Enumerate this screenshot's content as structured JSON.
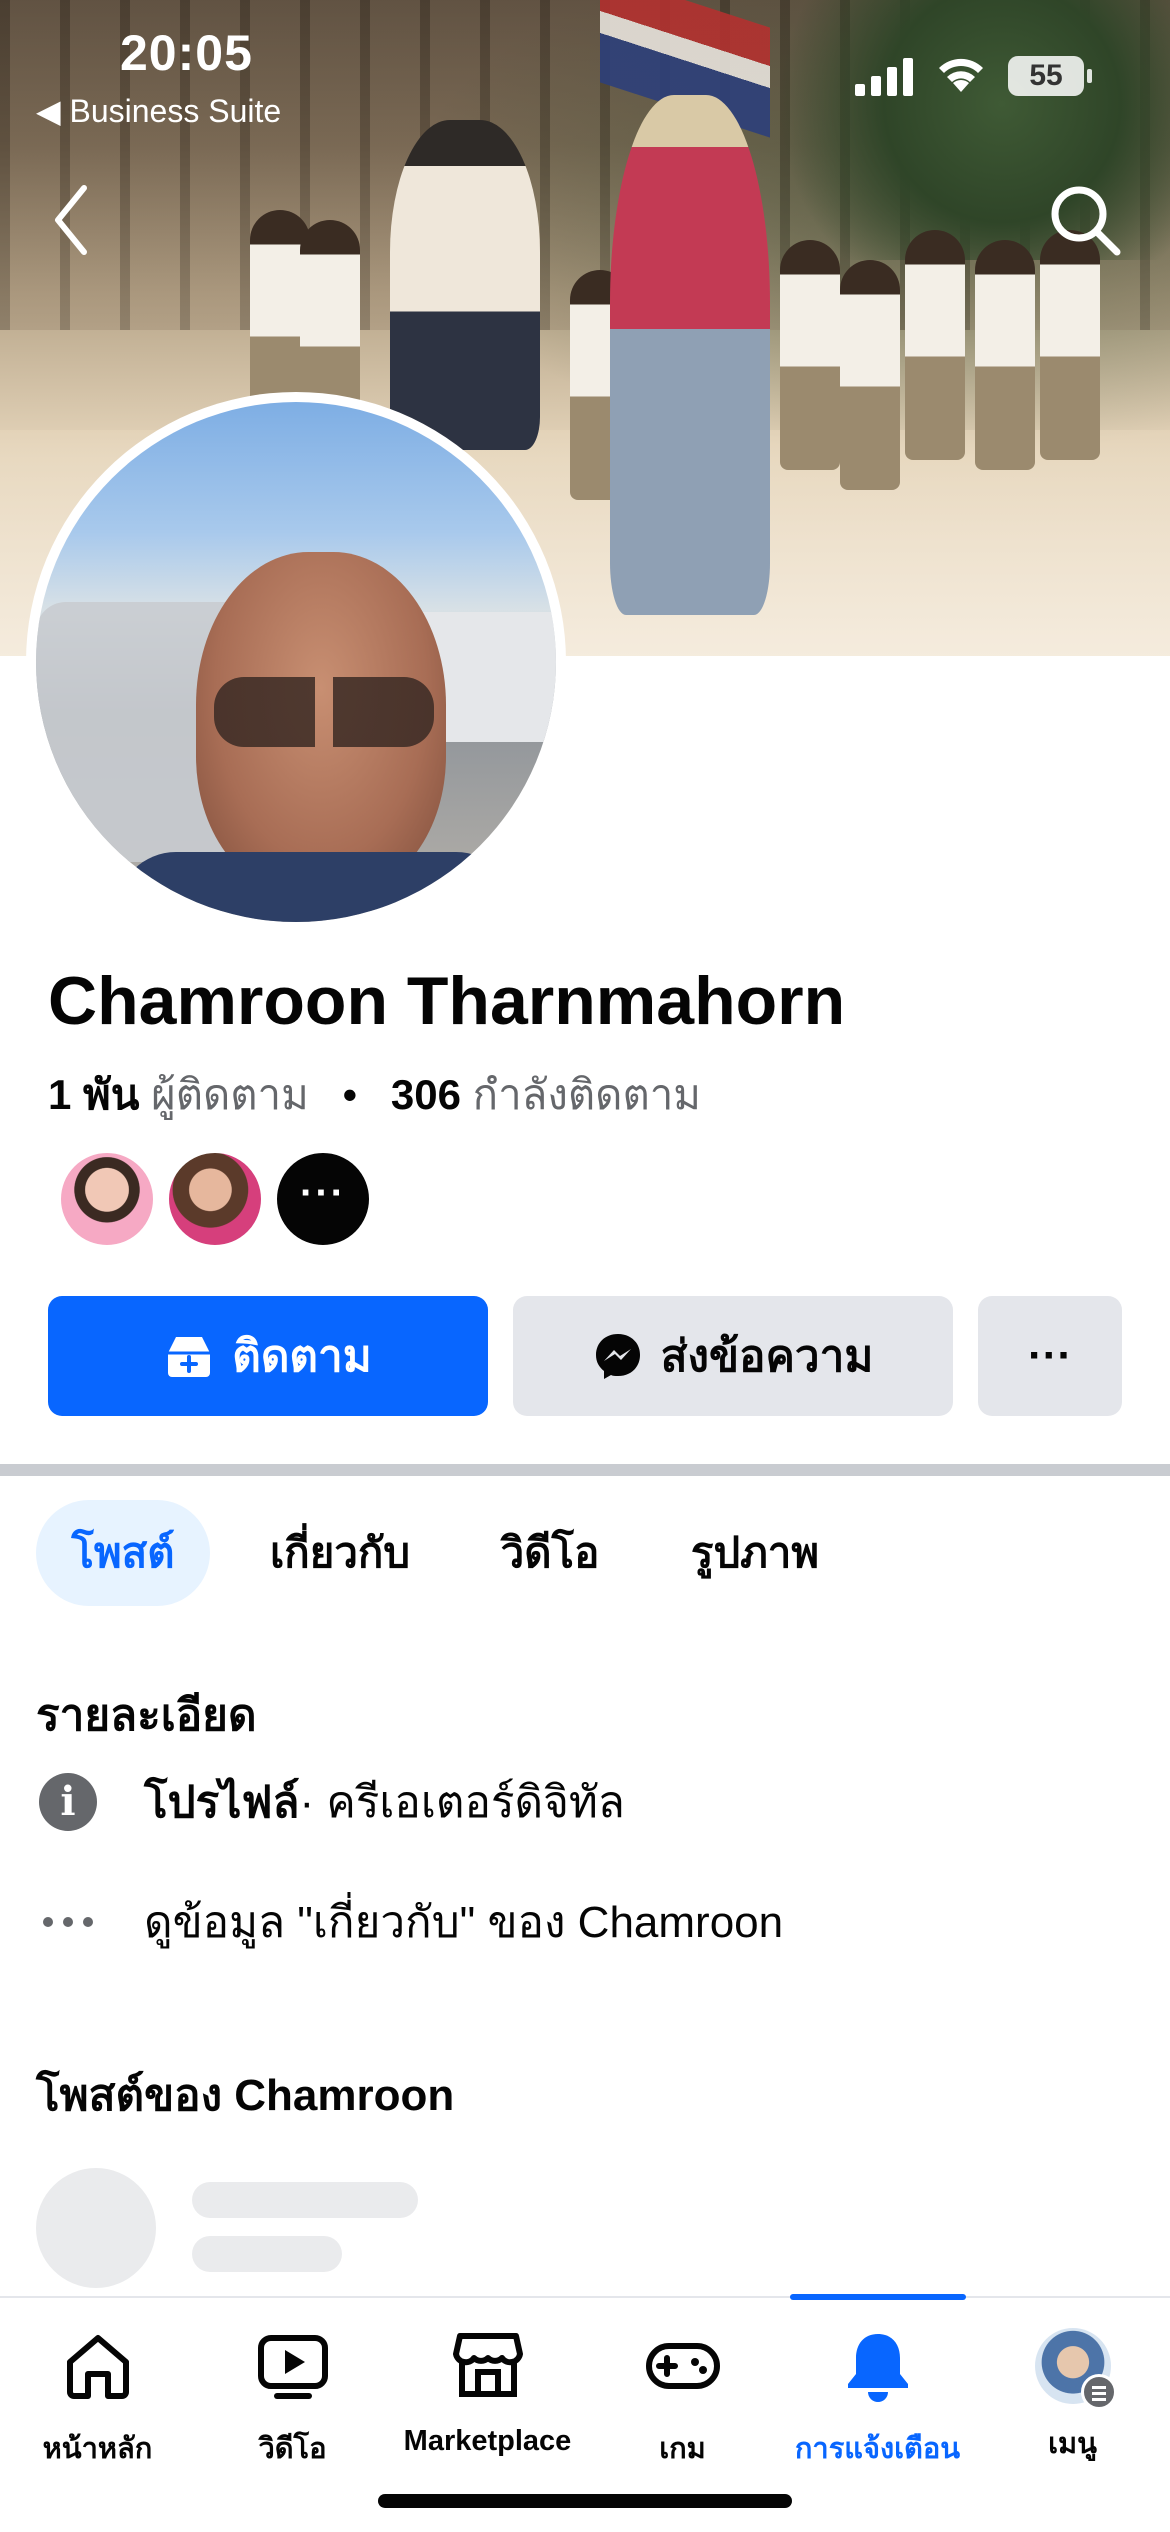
{
  "status_bar": {
    "time": "20:05",
    "back_app": "◀ Business Suite",
    "battery": "55"
  },
  "profile": {
    "name": "Chamroon Tharnmahorn",
    "followers_count": "1 พัน",
    "followers_label": "ผู้ติดตาม",
    "following_count": "306",
    "following_label": "กำลังติดตาม",
    "more_friends": "···"
  },
  "actions": {
    "follow": "ติดตาม",
    "message": "ส่งข้อความ",
    "more": "···"
  },
  "tabs": [
    {
      "label": "โพสต์",
      "active": true
    },
    {
      "label": "เกี่ยวกับ",
      "active": false
    },
    {
      "label": "วิดีโอ",
      "active": false
    },
    {
      "label": "รูปภาพ",
      "active": false
    }
  ],
  "details": {
    "title": "รายละเอียด",
    "profile_type_bold": "โปรไฟล์",
    "profile_type_rest": " · ครีเอเตอร์ดิจิทัล",
    "see_about": "ดูข้อมูล \"เกี่ยวกับ\" ของ Chamroon"
  },
  "posts": {
    "title": "โพสต์ของ Chamroon"
  },
  "bottom_nav": [
    {
      "label": "หน้าหลัก",
      "icon": "home-icon",
      "active": false
    },
    {
      "label": "วิดีโอ",
      "icon": "video-icon",
      "active": false
    },
    {
      "label": "Marketplace",
      "icon": "marketplace-icon",
      "active": false
    },
    {
      "label": "เกม",
      "icon": "gaming-icon",
      "active": false
    },
    {
      "label": "การแจ้งเตือน",
      "icon": "bell-icon",
      "active": true
    },
    {
      "label": "เมนู",
      "icon": "menu-avatar",
      "active": false
    }
  ],
  "colors": {
    "accent": "#0866ff",
    "active_tab_bg": "#e7f3ff",
    "secondary_button_bg": "#e4e6eb",
    "muted_text": "#65676b"
  }
}
